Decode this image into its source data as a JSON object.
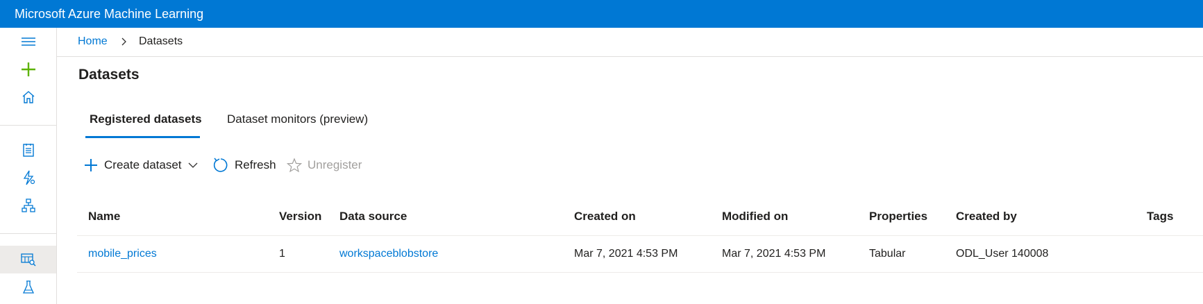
{
  "app": {
    "title": "Microsoft Azure Machine Learning"
  },
  "breadcrumb": {
    "home": "Home",
    "current": "Datasets"
  },
  "page": {
    "title": "Datasets"
  },
  "tabs": [
    {
      "label": "Registered datasets",
      "active": true
    },
    {
      "label": "Dataset monitors (preview)",
      "active": false
    }
  ],
  "toolbar": {
    "create_label": "Create dataset",
    "refresh_label": "Refresh",
    "unregister_label": "Unregister"
  },
  "table": {
    "columns": [
      "Name",
      "Version",
      "Data source",
      "Created on",
      "Modified on",
      "Properties",
      "Created by",
      "Tags"
    ],
    "rows": [
      {
        "name": "mobile_prices",
        "version": "1",
        "data_source": "workspaceblobstore",
        "created_on": "Mar 7, 2021 4:53 PM",
        "modified_on": "Mar 7, 2021 4:53 PM",
        "properties": "Tabular",
        "created_by": "ODL_User 140008",
        "tags": ""
      }
    ]
  },
  "leftnav": {
    "icons": [
      "hamburger-icon",
      "plus-icon",
      "home-icon",
      "notebook-icon",
      "automl-icon",
      "designer-icon",
      "datasets-icon",
      "experiments-icon"
    ]
  },
  "colors": {
    "accent": "#0078d4",
    "add_green": "#5db300",
    "disabled": "#a19f9d"
  }
}
